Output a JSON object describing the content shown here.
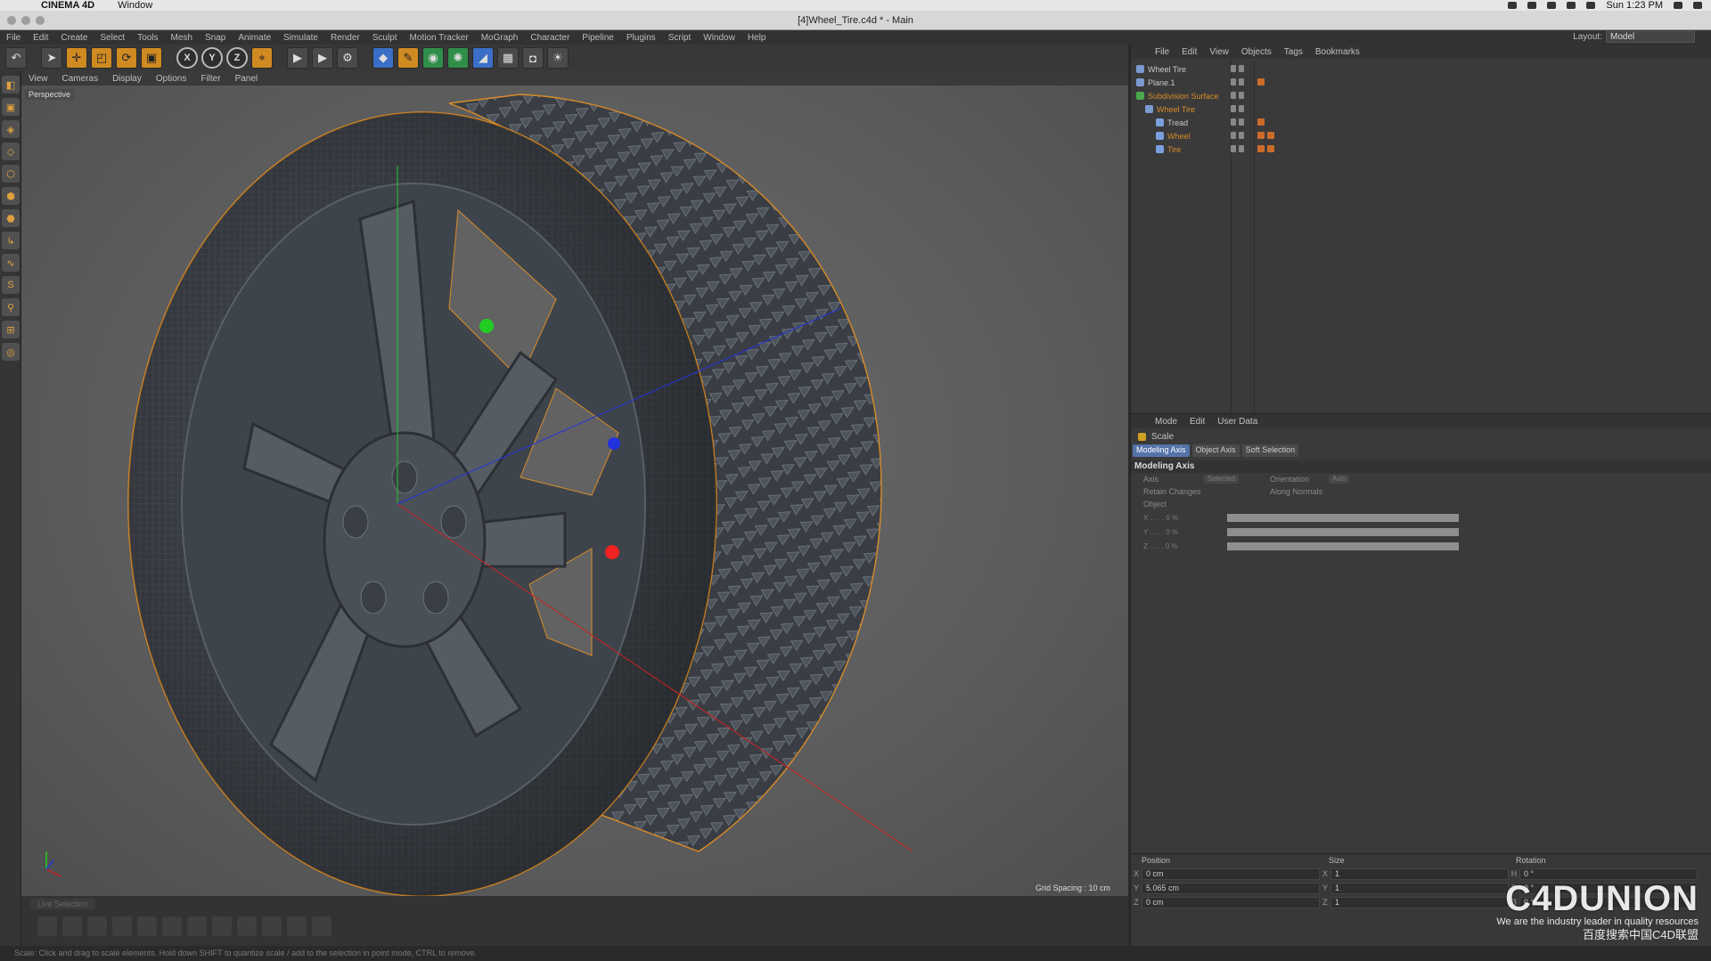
{
  "macbar": {
    "app_name": "CINEMA 4D",
    "menu_window": "Window",
    "clock": "Sun 1:23 PM"
  },
  "window": {
    "title": "[4]Wheel_Tire.c4d * - Main"
  },
  "menubar": {
    "items": [
      "File",
      "Edit",
      "Create",
      "Select",
      "Tools",
      "Mesh",
      "Snap",
      "Animate",
      "Simulate",
      "Render",
      "Sculpt",
      "Motion Tracker",
      "MoGraph",
      "Character",
      "Pipeline",
      "Plugins",
      "Script",
      "Window",
      "Help"
    ],
    "layout_label": "Layout:",
    "layout_value": "Model"
  },
  "toolbar": {
    "axis_x": "X",
    "axis_y": "Y",
    "axis_z": "Z"
  },
  "viewport": {
    "menu": [
      "View",
      "Cameras",
      "Display",
      "Options",
      "Filter",
      "Panel"
    ],
    "label": "Perspective",
    "grid_spacing": "Grid Spacing : 10 cm"
  },
  "object_manager": {
    "menu": [
      "File",
      "Edit",
      "View",
      "Objects",
      "Tags",
      "Bookmarks"
    ],
    "objects": [
      {
        "name": "Wheel Tire",
        "indent": 0,
        "highlight": false,
        "icon": "null-object-icon"
      },
      {
        "name": "Plane.1",
        "indent": 0,
        "highlight": false,
        "icon": "plane-object-icon"
      },
      {
        "name": "Subdivision Surface",
        "indent": 0,
        "highlight": true,
        "icon": "subdivision-surface-icon"
      },
      {
        "name": "Wheel Tire",
        "indent": 1,
        "highlight": true,
        "icon": "null-object-icon"
      },
      {
        "name": "Tread",
        "indent": 2,
        "highlight": false,
        "icon": "polygon-object-icon"
      },
      {
        "name": "Wheel",
        "indent": 2,
        "highlight": true,
        "icon": "polygon-object-icon"
      },
      {
        "name": "Tire",
        "indent": 2,
        "highlight": true,
        "icon": "polygon-object-icon"
      }
    ]
  },
  "attribute_manager": {
    "menu": [
      "Mode",
      "Edit",
      "User Data"
    ],
    "tool_name": "Scale",
    "tabs": [
      "Modeling Axis",
      "Object Axis",
      "Soft Selection"
    ],
    "active_tab": "Modeling Axis",
    "section": "Modeling Axis",
    "axis_label": "Axis",
    "axis_value": "Selected",
    "orientation_label": "Orientation",
    "orientation_value": "Axis",
    "retain_changes": "Retain Changes",
    "along_normals": "Along Normals",
    "object_label": "Object",
    "sliders": [
      {
        "label": "X . . . . 0 %",
        "value": 0
      },
      {
        "label": "Y . . . . 0 %",
        "value": 0
      },
      {
        "label": "Z . . . . 0 %",
        "value": 0
      }
    ]
  },
  "coordinates": {
    "headers": [
      "Position",
      "Size",
      "Rotation"
    ],
    "rows": [
      {
        "axis": "X",
        "position": "0 cm",
        "size_axis": "X",
        "size": "1",
        "rot_axis": "H",
        "rotation": "0 °"
      },
      {
        "axis": "Y",
        "position": "5.065 cm",
        "size_axis": "Y",
        "size": "1",
        "rot_axis": "P",
        "rotation": "0 °"
      },
      {
        "axis": "Z",
        "position": "0 cm",
        "size_axis": "Z",
        "size": "1",
        "rot_axis": "B",
        "rotation": "0 °"
      }
    ]
  },
  "bottom": {
    "tool_tabs": [
      "Live Selection"
    ],
    "status": "Scale: Click and drag to scale elements. Hold down SHIFT to quantize scale / add to the selection in point mode, CTRL to remove."
  },
  "watermark": {
    "logo": "C4DUNION",
    "slogan": "We are the industry leader in quality resources",
    "cn": "百度搜索中国C4D联盟"
  },
  "colors": {
    "accent_orange": "#d98c2a",
    "tab_active": "#5573a8",
    "handle_green": "#22cc22",
    "handle_red": "#ee2222",
    "handle_blue": "#2233dd"
  }
}
